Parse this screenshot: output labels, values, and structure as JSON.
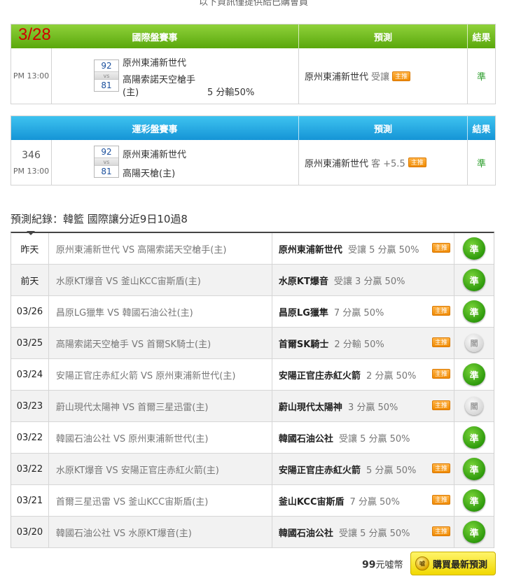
{
  "top_notice": "以下資訊僅提供給已購會員",
  "intl": {
    "date": "3/28",
    "header_event": "國際盤賽事",
    "header_pred": "預測",
    "header_result": "結果",
    "time": "PM 13:00",
    "score_top": "92",
    "score_vs": "vs",
    "score_bottom": "81",
    "team_top": "原州東浦新世代",
    "team_bottom": "高陽索諾天空槍手",
    "team_bottom_home": "(主)",
    "handicap": "5 分輸50%",
    "pred_team": "原州東浦新世代",
    "pred_note": "受讓",
    "badge": "主推",
    "result": "準"
  },
  "lottery": {
    "header_event": "運彩盤賽事",
    "header_pred": "預測",
    "header_result": "結果",
    "game_no": "346",
    "time": "PM 13:00",
    "score_top": "92",
    "score_vs": "vs",
    "score_bottom": "81",
    "team_top": "原州東浦新世代",
    "team_bottom": "高陽天槍(主)",
    "pred_team": "原州東浦新世代",
    "pred_note": "客 +5.5",
    "badge": "主推",
    "result": "準"
  },
  "record": {
    "title": "預測紀錄：韓籃 國際讓分近9日10過8",
    "rows": [
      {
        "date": "昨天",
        "match": "原州東浦新世代 VS 高陽索諾天空槍手(主)",
        "pred_team": "原州東浦新世代",
        "pred_note": "受讓 5 分贏 50%",
        "badge": "主推",
        "result": "準",
        "result_type": "win"
      },
      {
        "date": "前天",
        "match": "水原KT爆音 VS 釜山KCC宙斯盾(主)",
        "pred_team": "水原KT爆音",
        "pred_note": "受讓 3 分贏 50%",
        "badge": "",
        "result": "準",
        "result_type": "win"
      },
      {
        "date": "03/26",
        "match": "昌原LG獵隼 VS 韓國石油公社(主)",
        "pred_team": "昌原LG獵隼",
        "pred_note": "7 分贏 50%",
        "badge": "主推",
        "result": "準",
        "result_type": "win"
      },
      {
        "date": "03/25",
        "match": "高陽索諾天空槍手 VS 首爾SK騎士(主)",
        "pred_team": "首爾SK騎士",
        "pred_note": "2 分輸 50%",
        "badge": "主推",
        "result": "閻",
        "result_type": "tie"
      },
      {
        "date": "03/24",
        "match": "安陽正官庄赤紅火箭 VS 原州東浦新世代(主)",
        "pred_team": "安陽正官庄赤紅火箭",
        "pred_note": "2 分贏 50%",
        "badge": "主推",
        "result": "準",
        "result_type": "win"
      },
      {
        "date": "03/23",
        "match": "蔚山現代太陽神 VS 首爾三星迅雷(主)",
        "pred_team": "蔚山現代太陽神",
        "pred_note": "3 分贏 50%",
        "badge": "主推",
        "result": "閻",
        "result_type": "tie"
      },
      {
        "date": "03/22",
        "match": "韓國石油公社 VS 原州東浦新世代(主)",
        "pred_team": "韓國石油公社",
        "pred_note": "受讓 5 分贏 50%",
        "badge": "",
        "result": "準",
        "result_type": "win"
      },
      {
        "date": "03/22",
        "match": "水原KT爆音 VS 安陽正官庄赤紅火箭(主)",
        "pred_team": "安陽正官庄赤紅火箭",
        "pred_note": "5 分贏 50%",
        "badge": "主推",
        "result": "準",
        "result_type": "win"
      },
      {
        "date": "03/21",
        "match": "首爾三星迅雷 VS 釜山KCC宙斯盾(主)",
        "pred_team": "釜山KCC宙斯盾",
        "pred_note": "7 分贏 50%",
        "badge": "主推",
        "result": "準",
        "result_type": "win"
      },
      {
        "date": "03/20",
        "match": "韓國石油公社 VS 水原KT爆音(主)",
        "pred_team": "韓國石油公社",
        "pred_note": "受讓 5 分贏 50%",
        "badge": "主推",
        "result": "準",
        "result_type": "win"
      }
    ]
  },
  "footer": {
    "price": "99",
    "price_unit": "元噓幣",
    "coin_icon_text": "噓",
    "buy_label": "購買最新預測"
  },
  "colors": {
    "intl_header": "#6cbb1c",
    "lottery_header": "#23a6e2",
    "badge": "#f39c12",
    "win_ball": "#2e9a0c",
    "buy_button": "#f6e53a"
  }
}
